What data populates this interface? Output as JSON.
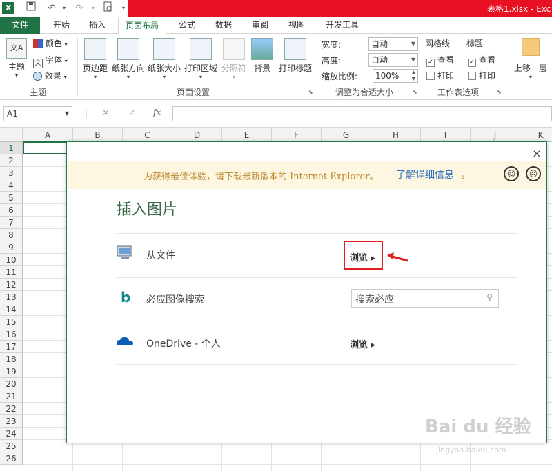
{
  "titlebar": {
    "app_icon": "X",
    "doc_title": "表格1.xlsx - Exc",
    "quick_access": [
      "save-icon",
      "undo-icon",
      "redo-icon",
      "print-preview-icon",
      "customize-icon"
    ]
  },
  "tabs": [
    "文件",
    "开始",
    "插入",
    "页面布局",
    "公式",
    "数据",
    "审阅",
    "视图",
    "开发工具"
  ],
  "ribbon": {
    "themes": {
      "label": "主题",
      "colors": "颜色",
      "fonts": "字体",
      "effects": "效果",
      "group": "主题"
    },
    "page_setup": {
      "margins": "页边距",
      "orientation": "纸张方向",
      "size": "纸张大小",
      "print_area": "打印区域",
      "breaks": "分隔符",
      "background": "背景",
      "print_titles": "打印标题",
      "group": "页面设置"
    },
    "scale": {
      "width_label": "宽度:",
      "width_value": "自动",
      "height_label": "高度:",
      "height_value": "自动",
      "scale_label": "缩放比例:",
      "scale_value": "100%",
      "group": "调整为合适大小"
    },
    "sheet_options": {
      "gridlines": "网格线",
      "headings": "标题",
      "view": "查看",
      "print": "打印",
      "group": "工作表选项"
    },
    "arrange": {
      "bring_forward": "上移一层"
    }
  },
  "formula_bar": {
    "name_box": "A1",
    "fx": "fx",
    "cancel": "✕",
    "enter": "✓"
  },
  "grid": {
    "columns": [
      "A",
      "B",
      "C",
      "D",
      "E",
      "F",
      "G",
      "H",
      "I",
      "J",
      "K"
    ],
    "rows": [
      "1",
      "2",
      "3",
      "4",
      "5",
      "6",
      "7",
      "8",
      "9",
      "10",
      "11",
      "12",
      "13",
      "14",
      "15",
      "16",
      "17",
      "18",
      "19",
      "20",
      "21",
      "22",
      "23",
      "24",
      "25",
      "26"
    ]
  },
  "dialog": {
    "close": "×",
    "ie_notice": "为获得最佳体验，请下载最新版本的 Internet Explorer。",
    "ie_link": "了解详细信息",
    "ie_link_dot": "。",
    "title": "插入图片",
    "options": [
      {
        "label": "从文件",
        "action": "浏览 ▸",
        "icon": "computer-icon"
      },
      {
        "label": "必应图像搜索",
        "search_placeholder": "搜索必应",
        "icon": "bing-icon"
      },
      {
        "label": "OneDrive - 个人",
        "action": "浏览 ▸",
        "icon": "onedrive-cloud-icon"
      }
    ]
  },
  "watermark": {
    "main": "Bai du 经验",
    "sub": "jingyan.baidu.com"
  },
  "colors": {
    "accent": "#217346",
    "title_red": "#e81123",
    "highlight": "#e02020"
  }
}
